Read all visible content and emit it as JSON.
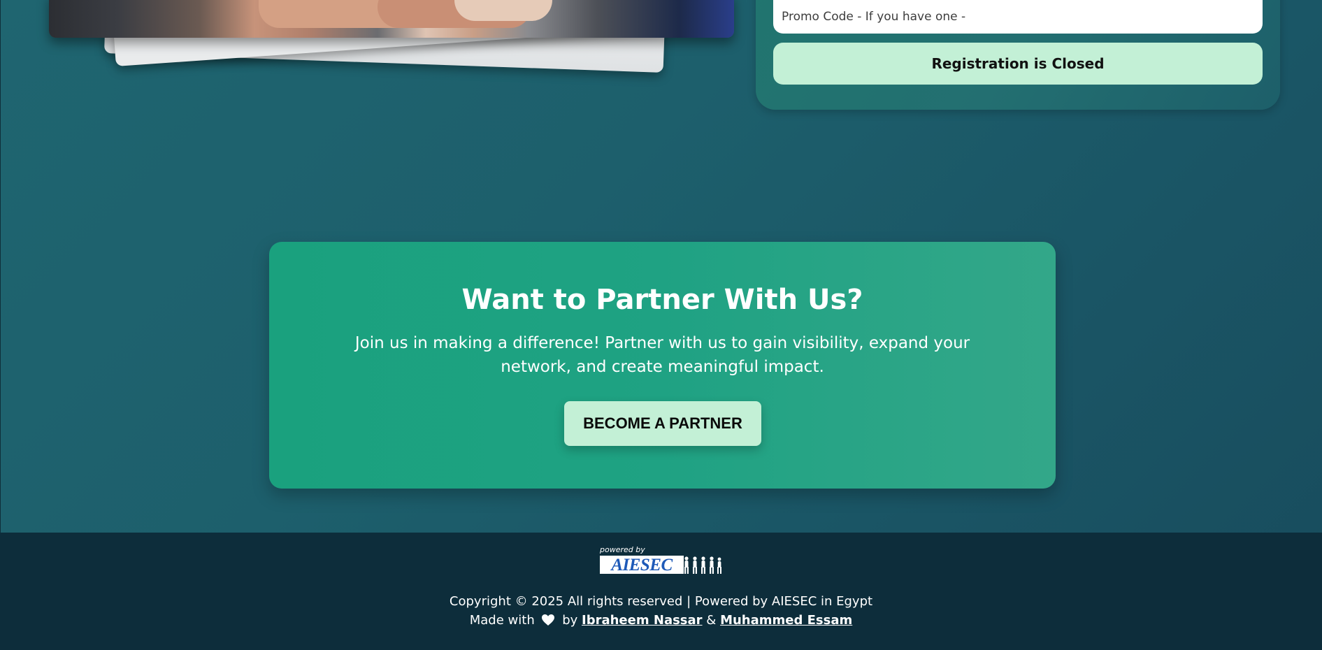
{
  "form": {
    "promo_placeholder": "Promo Code - If you have one -",
    "register_label": "Registration is Closed"
  },
  "partner": {
    "title": "Want to Partner With Us?",
    "text": "Join us in making a difference! Partner with us to gain visibility, expand your network, and create meaningful impact.",
    "button_label": "BECOME A PARTNER"
  },
  "footer": {
    "logo": {
      "powered_by": "powered by",
      "brand": "AIESEC"
    },
    "copyright": "Copyright © 2025 All rights reserved | Powered by AIESEC in Egypt",
    "made_with": "Made with",
    "by": "by",
    "amp": "&",
    "author1": "Ibraheem Nassar",
    "author2": "Muhammed Essam"
  },
  "colors": {
    "accent_button": "#c3f0d6",
    "partner_card": "#1fa283",
    "footer_bg": "#0d2d3b",
    "page_bg": "#1d5f6c"
  },
  "icons": {
    "heart": "heart-icon"
  }
}
